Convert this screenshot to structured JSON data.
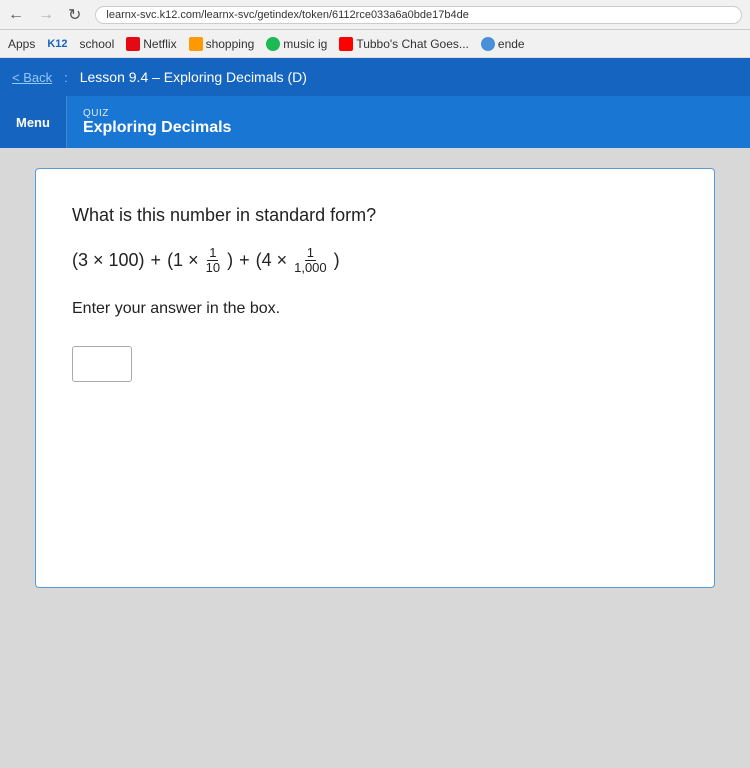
{
  "browser": {
    "url": "learnx-svc.k12.com/learnx-svc/getindex/token/6112rce033a6a0bde17b4de",
    "back_arrow": "←"
  },
  "bookmarks": {
    "items": [
      {
        "id": "apps",
        "label": "Apps",
        "icon_type": "text"
      },
      {
        "id": "k12",
        "label": "K12",
        "icon_type": "k12"
      },
      {
        "id": "school",
        "label": "school",
        "icon_type": "text"
      },
      {
        "id": "netflix",
        "label": "Netflix",
        "icon_type": "netflix"
      },
      {
        "id": "amazon",
        "label": "shopping",
        "icon_type": "amazon"
      },
      {
        "id": "music",
        "label": "music ig",
        "icon_type": "music"
      },
      {
        "id": "tubbo",
        "label": "Tubbo's Chat Goes...",
        "icon_type": "youtube"
      },
      {
        "id": "ende",
        "label": "ende",
        "icon_type": "other"
      }
    ]
  },
  "nav": {
    "back_label": "< Back",
    "separator": ":",
    "lesson_title": "Lesson 9.4 – Exploring Decimals (D)"
  },
  "lesson_header": {
    "menu_label": "Menu",
    "quiz_label": "QUIZ",
    "lesson_name": "Exploring Decimals"
  },
  "quiz": {
    "question": "What is this number in standard form?",
    "expression_parts": {
      "part1": "(3 × 100)",
      "plus1": "+",
      "part2_prefix": "(1 ×",
      "fraction1_num": "1",
      "fraction1_den": "10",
      "part2_suffix": ")",
      "plus2": "+",
      "part3_prefix": "(4 ×",
      "fraction2_num": "1",
      "fraction2_den": "1,000",
      "part3_suffix": ")"
    },
    "instruction": "Enter your answer in the box."
  }
}
